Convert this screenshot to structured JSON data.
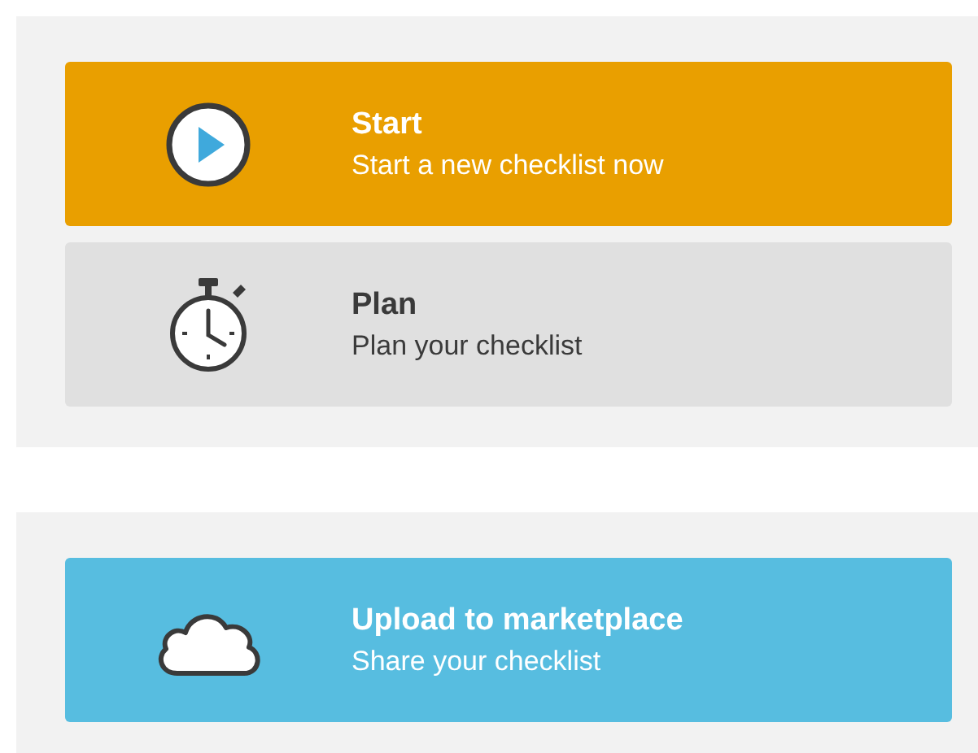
{
  "panels": [
    {
      "cards": [
        {
          "kind": "play",
          "color": "#e99f00",
          "title": "Start",
          "subtitle": "Start a new checklist now"
        },
        {
          "kind": "stopwatch",
          "color": "#e0e0e0",
          "title": "Plan",
          "subtitle": "Plan your checklist"
        }
      ]
    },
    {
      "cards": [
        {
          "kind": "cloud",
          "color": "#57bde0",
          "title": "Upload to marketplace",
          "subtitle": "Share your checklist"
        }
      ]
    }
  ]
}
